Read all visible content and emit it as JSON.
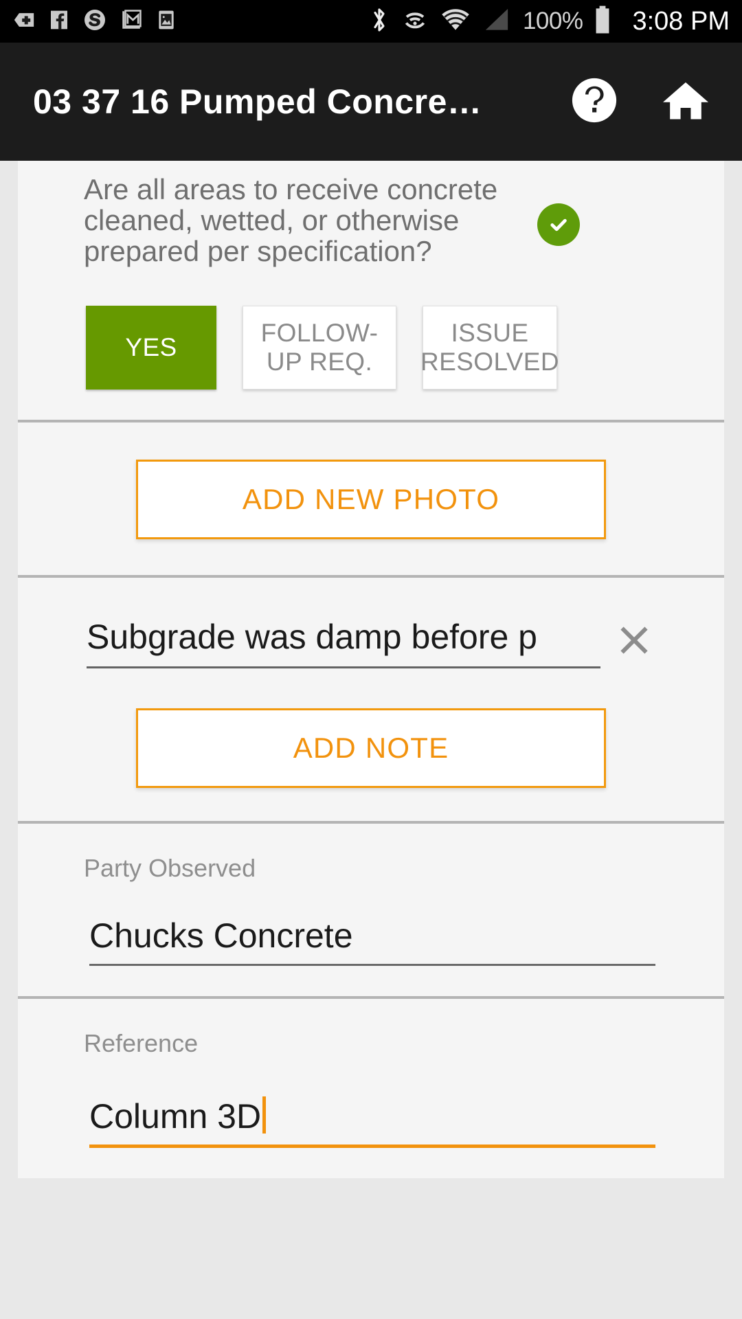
{
  "status_bar": {
    "icons_left": [
      "add-plus-icon",
      "facebook-icon",
      "skype-icon",
      "gmail-icon",
      "photo-icon"
    ],
    "icons_right": [
      "bluetooth-icon",
      "wifi-hotspot-icon",
      "wifi-icon",
      "cellular-signal-icon"
    ],
    "battery_percent": "100%",
    "battery_icon": "battery-full-icon",
    "clock": "3:08 PM"
  },
  "app_bar": {
    "title": "03 37 16 Pumped Concre…",
    "help_icon": "help-circle-icon",
    "home_icon": "home-icon"
  },
  "question_section": {
    "text": "Are all areas to receive concrete cleaned, wetted, or otherwise prepared per specification?",
    "status_icon": "check-circle-icon",
    "status_color": "#5f9c0a",
    "answers": [
      {
        "label": "YES",
        "selected": true
      },
      {
        "label": "FOLLOW-UP REQ.",
        "selected": false
      },
      {
        "label": "ISSUE RESOLVED",
        "selected": false
      }
    ]
  },
  "photo_section": {
    "add_photo_label": "ADD NEW PHOTO"
  },
  "note_section": {
    "note_value": "Subgrade was damp before p",
    "note_placeholder": "",
    "clear_icon": "close-x-icon",
    "add_note_label": "ADD NOTE"
  },
  "party_section": {
    "label": "Party Observed",
    "value": "Chucks Concrete"
  },
  "reference_section": {
    "label": "Reference",
    "value": "Column 3D",
    "focused": true
  },
  "colors": {
    "accent_orange": "#f2920d",
    "accent_green": "#669900",
    "card_bg": "#f5f5f5",
    "page_bg": "#e8e8e8",
    "app_bar_bg": "#1c1c1c"
  }
}
